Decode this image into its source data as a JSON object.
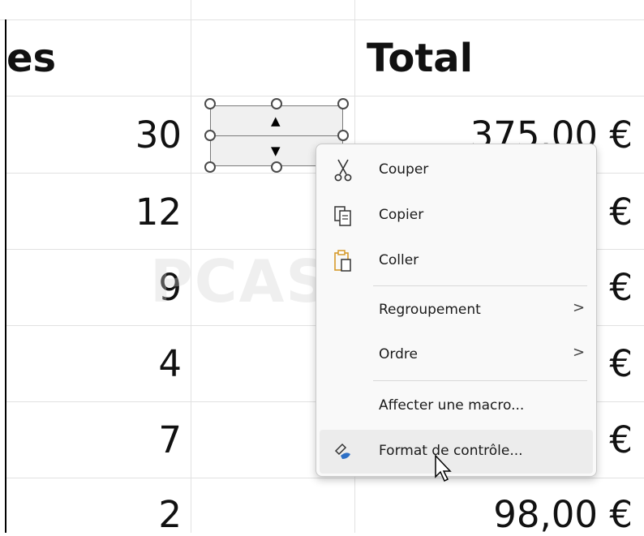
{
  "sheet": {
    "header_partial": "es",
    "header_total": "Total",
    "quantities": [
      "30",
      "12",
      "9",
      "4",
      "7",
      "2"
    ],
    "totals": [
      "375,00 €",
      "€",
      "€",
      "€",
      "€",
      "98,00 €"
    ]
  },
  "watermark": "PCASTUCES",
  "context_menu": {
    "items": [
      {
        "label": "Couper",
        "icon": "scissors-icon"
      },
      {
        "label": "Copier",
        "icon": "copy-icon"
      },
      {
        "label": "Coller",
        "icon": "paste-icon"
      },
      {
        "label": "Regroupement",
        "submenu": true
      },
      {
        "label": "Ordre",
        "submenu": true
      },
      {
        "label": "Affecter une macro..."
      },
      {
        "label": "Format de contrôle...",
        "icon": "format-control-icon",
        "hovered": true
      }
    ]
  },
  "colors": {
    "menu_background": "#f9f9f9",
    "hover_background": "#ececec",
    "control_face": "#f0f0f0",
    "paste_icon_accent": "#d69a2a",
    "brush_icon_accent": "#2d6fc5"
  }
}
